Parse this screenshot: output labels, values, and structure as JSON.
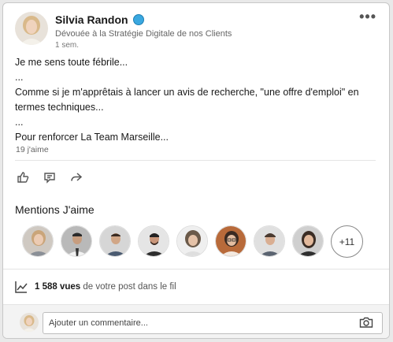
{
  "author": {
    "name": "Silvia Randon",
    "headline": "Dévouée à la Stratégie Digitale de nos Clients",
    "time": "1 sem."
  },
  "post": {
    "lines": [
      "Je me sens toute fébrile...",
      "...",
      "Comme si je m'apprêtais à lancer un avis de recherche, \"une offre d'emploi\" en",
      "termes techniques...",
      "...",
      "Pour renforcer La Team Marseille..."
    ]
  },
  "reactions": {
    "likes": "19 j'aime"
  },
  "actions": [
    "like-icon",
    "comment-icon",
    "share-icon"
  ],
  "mentions": {
    "title": "Mentions J'aime",
    "more": "+11"
  },
  "views": {
    "count": "1 588 vues",
    "suffix": " de votre post dans le fil"
  },
  "comment": {
    "placeholder": "Ajouter un commentaire..."
  },
  "colors": {
    "verified": "#3aa8e0",
    "background": "#e9e9e9"
  }
}
